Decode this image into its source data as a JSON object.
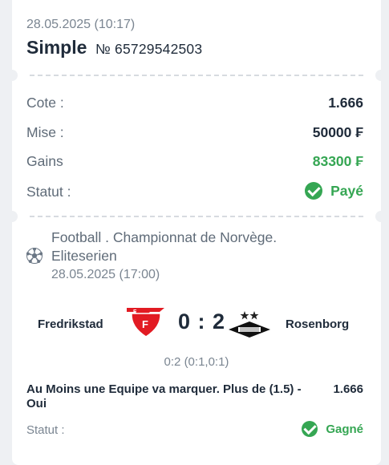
{
  "header": {
    "date": "28.05.2025 (10:17)",
    "type": "Simple",
    "number": "№ 65729542503"
  },
  "summary": {
    "odds_label": "Cote :",
    "odds_value": "1.666",
    "stake_label": "Mise :",
    "stake_value": "50000 ₣",
    "win_label": "Gains",
    "win_value": "83300 ₣",
    "status_label": "Statut :",
    "status_value": "Payé"
  },
  "event": {
    "league_line1": "Football . Championnat de Norvège.",
    "league_line2": "Eliteserien",
    "date": "28.05.2025 (17:00)",
    "home_team": "Fredrikstad",
    "away_team": "Rosenborg",
    "score": "0 : 2",
    "score_detail": "0:2 (0:1,0:1)",
    "market": "Au Moins une Equipe va marquer. Plus de (1.5) - Oui",
    "market_odds": "1.666",
    "status_label": "Statut :",
    "status_value": "Gagné"
  },
  "colors": {
    "green": "#35a653",
    "text_dark": "#1f2b3a",
    "text_muted": "#5f6b78",
    "background": "#eef0f3"
  }
}
